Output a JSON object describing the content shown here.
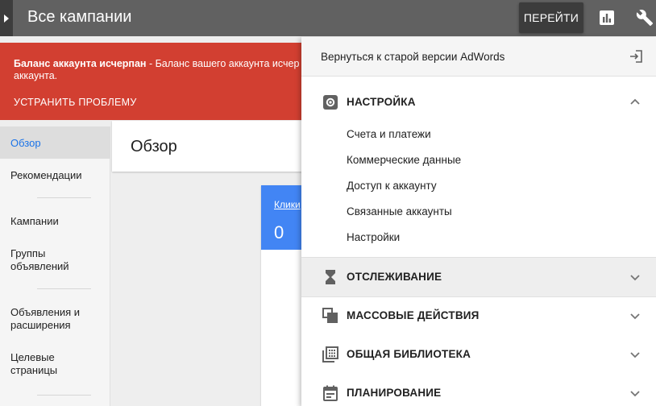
{
  "topbar": {
    "title": "Все кампании",
    "goto_label": "ПЕРЕЙТИ",
    "icons": [
      "expand-arrow-icon",
      "bar-chart-icon",
      "wrench-icon"
    ]
  },
  "alert": {
    "bold": "Баланс аккаунта исчерпан",
    "text": " - Баланс вашего аккаунта исчер",
    "text2": "аккаунта.",
    "action": "УСТРАНИТЬ ПРОБЛЕМУ"
  },
  "leftnav": {
    "items": [
      {
        "label": "Обзор",
        "active": true
      },
      {
        "label": "Рекомендации"
      },
      {
        "label": "Кампании"
      },
      {
        "label": "Группы\nобъявлений"
      },
      {
        "label": "Объявления и\nрасширения"
      },
      {
        "label": "Целевые\nстраницы"
      }
    ]
  },
  "main": {
    "title": "Обзор",
    "card": {
      "label": "Клики",
      "value": "0"
    }
  },
  "panel": {
    "return_label": "Вернуться к старой версии AdWords",
    "sections": [
      {
        "title": "НАСТРОЙКА",
        "icon": "gear-icon",
        "expanded": true,
        "items": [
          "Счета и платежи",
          "Коммерческие данные",
          "Доступ к аккаунту",
          "Связанные аккаунты",
          "Настройки"
        ]
      },
      {
        "title": "ОТСЛЕЖИВАНИЕ",
        "icon": "hourglass-icon",
        "expanded": false
      },
      {
        "title": "МАССОВЫЕ ДЕЙСТВИЯ",
        "icon": "copy-icon",
        "expanded": false
      },
      {
        "title": "ОБЩАЯ БИБЛИОТЕКА",
        "icon": "library-icon",
        "expanded": false
      },
      {
        "title": "ПЛАНИРОВАНИЕ",
        "icon": "calendar-icon",
        "expanded": false
      }
    ]
  },
  "colors": {
    "topbar": "#616161",
    "alert": "#d23f31",
    "accent_blue": "#4285f4",
    "active_link": "#1a73e8"
  }
}
